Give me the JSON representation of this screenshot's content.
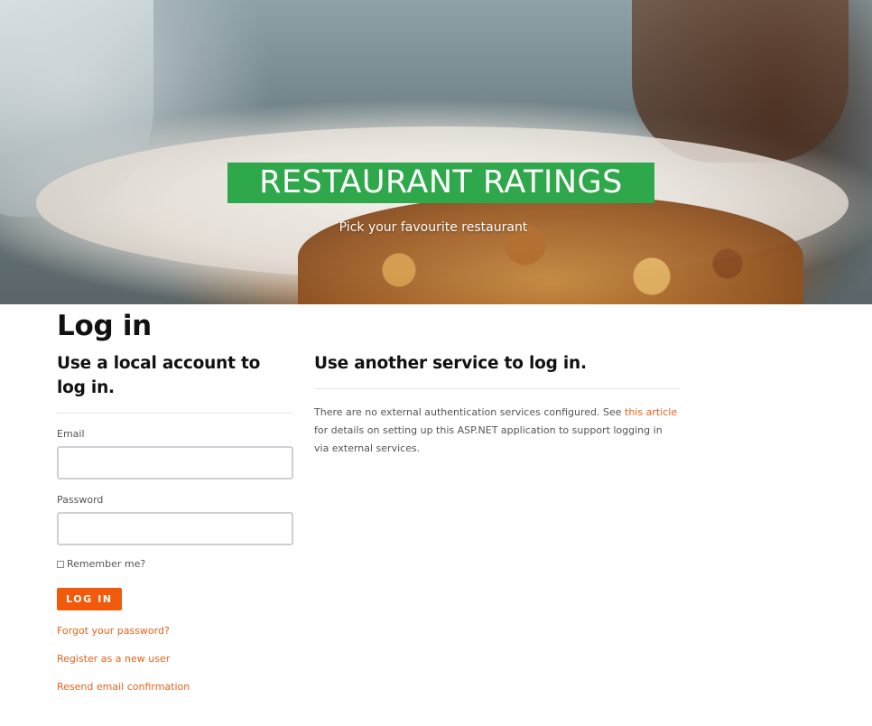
{
  "hero": {
    "title": "RESTAURANT RATINGS",
    "subtitle": "Pick your favourite restaurant",
    "title_bg_color": "#2ea84a"
  },
  "page": {
    "title": "Log in"
  },
  "local_login": {
    "heading": "Use a local account to log in.",
    "email_label": "Email",
    "email_value": "",
    "password_label": "Password",
    "password_value": "",
    "remember_label": "Remember me?",
    "remember_checked": false,
    "submit_label": "Log in",
    "forgot_password_link": "Forgot your password?",
    "register_link": "Register as a new user",
    "resend_link": "Resend email confirmation"
  },
  "external_login": {
    "heading": "Use another service to log in.",
    "text_before": "There are no external authentication services configured. See ",
    "link_text": "this article",
    "text_after": " for details on setting up this ASP.NET application to support logging in via external services."
  },
  "colors": {
    "accent": "#f05a0a",
    "link": "#e8611a"
  }
}
